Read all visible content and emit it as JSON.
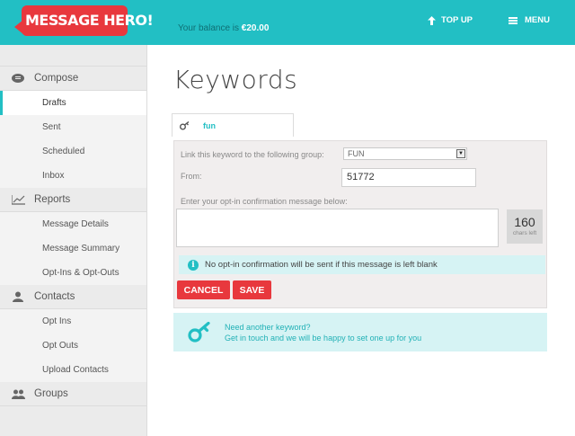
{
  "header": {
    "logo_text": "MESSAGE HERO!",
    "balance_label": "Your balance is",
    "balance_value": "€20.00",
    "topup_label": "TOP UP",
    "menu_label": "MENU",
    "accent_color": "#22bfc4",
    "brand_color": "#e8383d"
  },
  "sidebar": {
    "sections": [
      {
        "label": "Compose",
        "icon": "chat-bubble-icon",
        "items": [
          "Drafts",
          "Sent",
          "Scheduled",
          "Inbox"
        ]
      },
      {
        "label": "Reports",
        "icon": "chart-icon",
        "items": [
          "Message Details",
          "Message Summary",
          "Opt-Ins & Opt-Outs"
        ]
      },
      {
        "label": "Contacts",
        "icon": "person-icon",
        "items": [
          "Opt Ins",
          "Opt Outs",
          "Upload Contacts"
        ]
      },
      {
        "label": "Groups",
        "icon": "people-icon",
        "items": []
      }
    ],
    "active_item": "Drafts"
  },
  "main": {
    "title": "Keywords",
    "keyword_tab": "fun",
    "form": {
      "group_label": "Link this keyword to the following group:",
      "group_value": "FUN",
      "from_label": "From:",
      "from_value": "51772",
      "message_label": "Enter your opt-in confirmation message below:",
      "message_value": "",
      "chars_left_value": "160",
      "chars_left_label": "chars left",
      "notice": "No opt-in confirmation will be sent if this message is left blank",
      "cancel_label": "CANCEL",
      "save_label": "SAVE"
    },
    "help": {
      "line1": "Need another keyword?",
      "line2": "Get in touch and we will be happy to set one up for you"
    }
  }
}
